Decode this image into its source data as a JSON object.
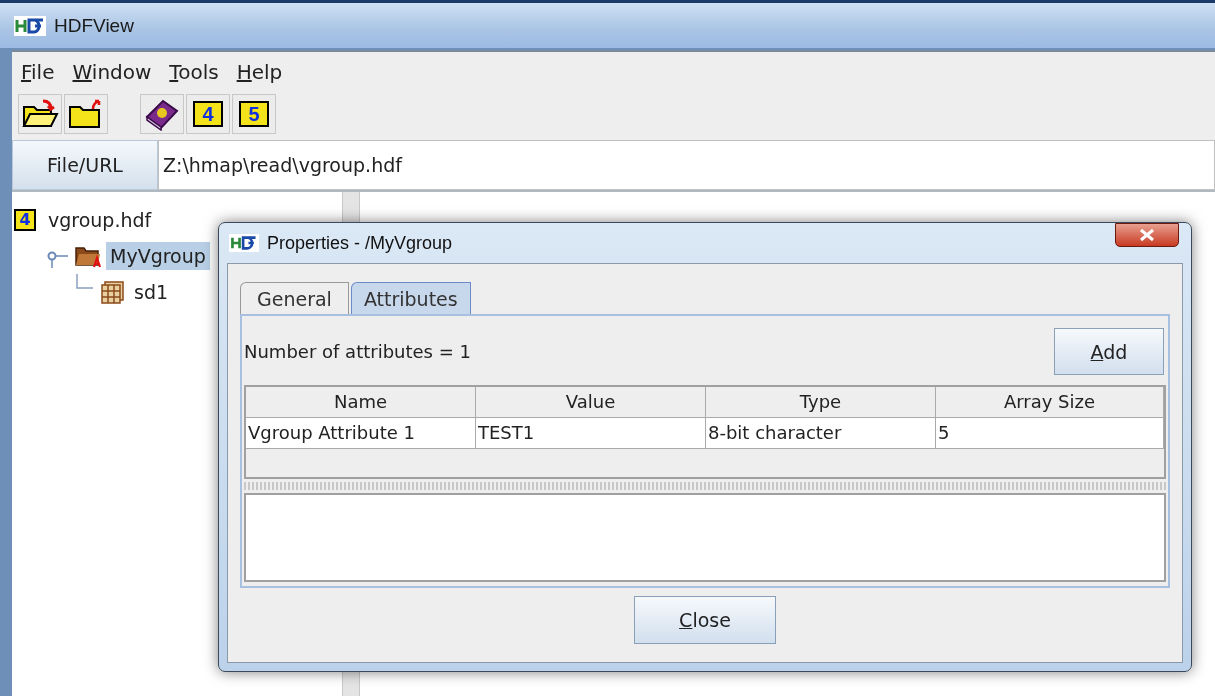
{
  "window": {
    "title": "HDFView"
  },
  "menu": [
    {
      "key": "F",
      "rest": "ile"
    },
    {
      "key": "W",
      "rest": "indow"
    },
    {
      "key": "T",
      "rest": "ools"
    },
    {
      "key": "H",
      "rest": "elp"
    }
  ],
  "toolbar": [
    {
      "kind": "open"
    },
    {
      "kind": "close"
    },
    {
      "kind": "help"
    },
    {
      "kind": "hdf",
      "label": "4"
    },
    {
      "kind": "hdf",
      "label": "5"
    }
  ],
  "url_bar": {
    "button": "File/URL",
    "value": "Z:\\hmap\\read\\vgroup.hdf"
  },
  "tree": {
    "label": "vgroup.hdf",
    "badge": "4",
    "kind": "file",
    "selected": false,
    "children": [
      {
        "label": "MyVgroup",
        "kind": "group",
        "selected": true,
        "children": [
          {
            "label": "sd1",
            "kind": "dataset",
            "selected": false
          }
        ]
      }
    ]
  },
  "dialog": {
    "title": "Properties - /MyVgroup",
    "tabs": [
      {
        "label": "General",
        "selected": false
      },
      {
        "label": "Attributes",
        "selected": true
      }
    ],
    "count_text": "Number of attributes = 1",
    "add_button": {
      "key": "A",
      "rest": "dd"
    },
    "table": {
      "columns": [
        "Name",
        "Value",
        "Type",
        "Array Size"
      ],
      "rows": [
        [
          "Vgroup Attribute 1",
          "TEST1",
          "8-bit character",
          "5"
        ]
      ]
    },
    "close_button": {
      "key": "C",
      "rest": "lose"
    }
  }
}
